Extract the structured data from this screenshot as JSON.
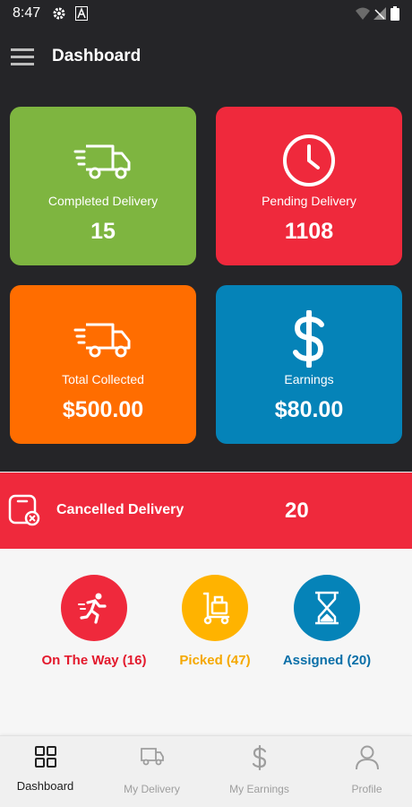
{
  "status_bar": {
    "time": "8:47",
    "icons": [
      "gear-icon",
      "a-icon",
      "wifi-icon",
      "signal-icon",
      "battery-icon"
    ]
  },
  "app_bar": {
    "menu_icon": "hamburger-menu-icon",
    "title": "Dashboard"
  },
  "cards": [
    {
      "label": "Completed Delivery",
      "value": "15",
      "icon": "delivery-truck-icon",
      "color": "#7eb540"
    },
    {
      "label": "Pending Delivery",
      "value": "1108",
      "icon": "clock-icon",
      "color": "#ef293c"
    },
    {
      "label": "Total Collected",
      "value": "$500.00",
      "icon": "delivery-truck-icon",
      "color": "#ff6d00"
    },
    {
      "label": "Earnings",
      "value": "$80.00",
      "icon": "dollar-icon",
      "color": "#0583b8"
    }
  ],
  "cancelled": {
    "label": "Cancelled Delivery",
    "value": "20",
    "icon": "cancel-box-icon",
    "color": "#ef293c"
  },
  "statuses": [
    {
      "label": "On The Way (16)",
      "icon": "runner-icon",
      "color": "#ef293c"
    },
    {
      "label": "Picked (47)",
      "icon": "hand-truck-icon",
      "color": "#ffb300"
    },
    {
      "label": "Assigned (20)",
      "icon": "hourglass-icon",
      "color": "#0583b8"
    }
  ],
  "bottom_nav": [
    {
      "label": "Dashboard",
      "icon": "grid-icon",
      "active": true
    },
    {
      "label": "My Delivery",
      "icon": "delivery-truck-icon",
      "active": false
    },
    {
      "label": "My Earnings",
      "icon": "dollar-icon",
      "active": false
    },
    {
      "label": "Profile",
      "icon": "person-icon",
      "active": false
    }
  ]
}
